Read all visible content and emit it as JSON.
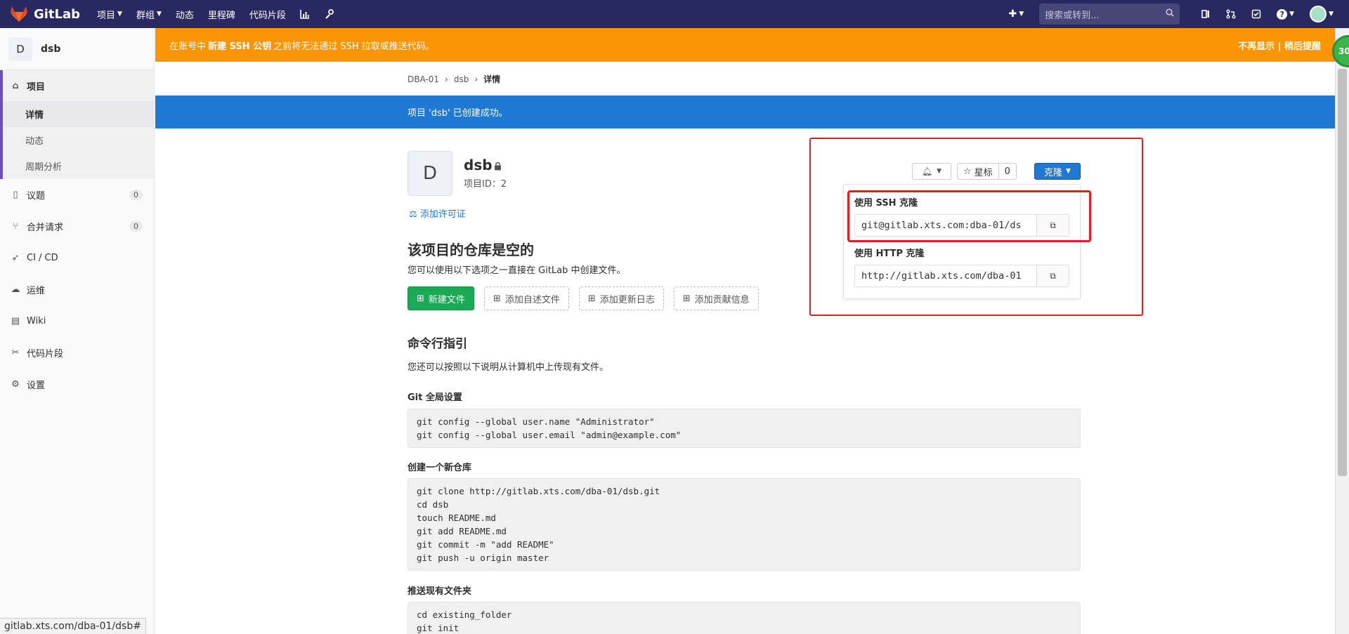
{
  "navbar": {
    "brand": "GitLab",
    "items": [
      "项目",
      "群组",
      "动态",
      "里程碑",
      "代码片段"
    ],
    "search_placeholder": "搜索或转到..."
  },
  "sidebar": {
    "project_letter": "D",
    "project_name": "dsb",
    "group_title": "项目",
    "group_sub": [
      "详情",
      "动态",
      "周期分析"
    ],
    "items": [
      {
        "label": "议题",
        "count": "0"
      },
      {
        "label": "合并请求",
        "count": "0"
      },
      {
        "label": "CI / CD"
      },
      {
        "label": "运维"
      },
      {
        "label": "Wiki"
      },
      {
        "label": "代码片段"
      },
      {
        "label": "设置"
      }
    ],
    "status_url": "gitlab.xts.com/dba-01/dsb#"
  },
  "warning": {
    "prefix": "在账号中",
    "strong": "新建 SSH 公钥",
    "suffix": "之前将无法通过 SSH 拉取或推送代码。",
    "dismiss": "不再显示",
    "sep": "|",
    "later": "稍后提醒"
  },
  "breadcrumb": [
    "DBA-01",
    "dsb",
    "详情"
  ],
  "flash": "项目 'dsb' 已创建成功。",
  "project": {
    "letter": "D",
    "name": "dsb",
    "id_text": "项目ID：2",
    "license": "添加许可证"
  },
  "empty": {
    "title": "该项目的仓库是空的",
    "desc": "您可以使用以下选项之一直接在 GitLab 中创建文件。",
    "buttons": [
      "新建文件",
      "添加自述文件",
      "添加更新日志",
      "添加贡献信息"
    ]
  },
  "cli": {
    "title": "命令行指引",
    "desc": "您还可以按照以下说明从计算机中上传现有文件。",
    "sections": [
      {
        "title": "Git 全局设置",
        "lines": [
          "git config --global user.name \"Administrator\"",
          "git config --global user.email \"admin@example.com\""
        ]
      },
      {
        "title": "创建一个新仓库",
        "lines": [
          "git clone http://gitlab.xts.com/dba-01/dsb.git",
          "cd dsb",
          "touch README.md",
          "git add README.md",
          "git commit -m \"add README\"",
          "git push -u origin master"
        ]
      },
      {
        "title": "推送现有文件夹",
        "lines": [
          "cd existing_folder",
          "git init"
        ]
      }
    ]
  },
  "actions": {
    "star_label": "星标",
    "star_count": "0",
    "clone_label": "克隆"
  },
  "clone": {
    "ssh_label": "使用 SSH 克隆",
    "ssh_value": "git@gitlab.xts.com:dba-01/ds",
    "http_label": "使用 HTTP 克隆",
    "http_value": "http://gitlab.xts.com/dba-01"
  },
  "circle_badge": "30",
  "colors": {
    "navbar": "#292961",
    "warning": "#fc9403",
    "flash": "#1f78d1",
    "annotation": "#e02020"
  }
}
